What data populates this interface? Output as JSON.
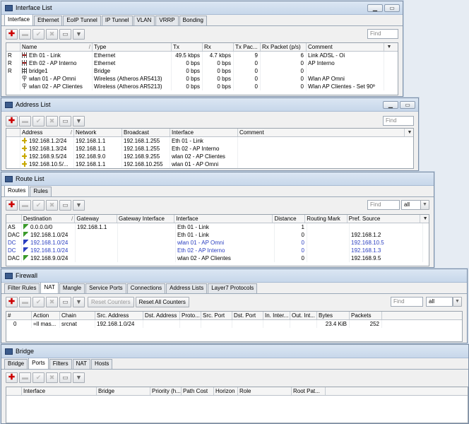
{
  "interface_list": {
    "title": "Interface List",
    "tabs": [
      "Interface",
      "Ethernet",
      "EoIP Tunnel",
      "IP Tunnel",
      "VLAN",
      "VRRP",
      "Bonding"
    ],
    "find": "Find",
    "minimize": "▁",
    "restore": "▭",
    "columns": [
      "Name",
      "Type",
      "Tx",
      "Rx",
      "Tx Pac...",
      "Rx Packet (p/s)",
      "Comment"
    ],
    "rows": [
      {
        "flag": "R",
        "icon": "ethernet-icon",
        "name": "Eth 01 - Link",
        "type": "Ethernet",
        "tx": "49.5 kbps",
        "rx": "4.7 kbps",
        "txp": "9",
        "rxp": "6",
        "comment": "Link ADSL - Oi"
      },
      {
        "flag": "R",
        "icon": "ethernet-icon",
        "name": "Eth 02 - AP Interno",
        "type": "Ethernet",
        "tx": "0 bps",
        "rx": "0 bps",
        "txp": "0",
        "rxp": "0",
        "comment": "AP Interno"
      },
      {
        "flag": "R",
        "icon": "bridge-icon",
        "name": "bridge1",
        "type": "Bridge",
        "tx": "0 bps",
        "rx": "0 bps",
        "txp": "0",
        "rxp": "0",
        "comment": ""
      },
      {
        "flag": "",
        "icon": "wireless-icon",
        "name": "wlan 01 - AP Omni",
        "type": "Wireless (Atheros AR5413)",
        "tx": "0 bps",
        "rx": "0 bps",
        "txp": "0",
        "rxp": "0",
        "comment": "Wlan AP Omni"
      },
      {
        "flag": "",
        "icon": "wireless-icon",
        "name": "wlan 02 - AP Clientes",
        "type": "Wireless (Atheros AR5213)",
        "tx": "0 bps",
        "rx": "0 bps",
        "txp": "0",
        "rxp": "0",
        "comment": "Wlan AP Clientes - Set 90º"
      }
    ]
  },
  "address_list": {
    "title": "Address List",
    "find": "Find",
    "columns": [
      "Address",
      "Network",
      "Broadcast",
      "Interface",
      "Comment"
    ],
    "rows": [
      {
        "address": "192.168.1.2/24",
        "network": "192.168.1.1",
        "broadcast": "192.168.1.255",
        "interface": "Eth 01 - Link"
      },
      {
        "address": "192.168.1.3/24",
        "network": "192.168.1.1",
        "broadcast": "192.168.1.255",
        "interface": "Eth 02 - AP Interno"
      },
      {
        "address": "192.168.9.5/24",
        "network": "192.168.9.0",
        "broadcast": "192.168.9.255",
        "interface": "wlan 02 - AP Clientes"
      },
      {
        "address": "192.168.10.5/...",
        "network": "192.168.1.1",
        "broadcast": "192.168.10.255",
        "interface": "wlan 01 - AP Omni"
      }
    ]
  },
  "route_list": {
    "title": "Route List",
    "tabs": [
      "Routes",
      "Rules"
    ],
    "find": "Find",
    "filter": "all",
    "columns": [
      "Destination",
      "Gateway",
      "Gateway Interface",
      "Interface",
      "Distance",
      "Routing Mark",
      "Pref. Source"
    ],
    "rows": [
      {
        "flag": "AS",
        "dest": "0.0.0.0/0",
        "gateway": "192.168.1.1",
        "gwif": "",
        "iface": "Eth 01 - Link",
        "distance": "1",
        "mark": "",
        "pref": "",
        "blue": false
      },
      {
        "flag": "DAC",
        "dest": "192.168.1.0/24",
        "gateway": "",
        "gwif": "",
        "iface": "Eth 01 - Link",
        "distance": "0",
        "mark": "",
        "pref": "192.168.1.2",
        "blue": false
      },
      {
        "flag": "DC",
        "dest": "192.168.1.0/24",
        "gateway": "",
        "gwif": "",
        "iface": "wlan 01 - AP Omni",
        "distance": "0",
        "mark": "",
        "pref": "192.168.10.5",
        "blue": true
      },
      {
        "flag": "DC",
        "dest": "192.168.1.0/24",
        "gateway": "",
        "gwif": "",
        "iface": "Eth 02 - AP Interno",
        "distance": "0",
        "mark": "",
        "pref": "192.168.1.3",
        "blue": true
      },
      {
        "flag": "DAC",
        "dest": "192.168.9.0/24",
        "gateway": "",
        "gwif": "",
        "iface": "wlan 02 - AP Clientes",
        "distance": "0",
        "mark": "",
        "pref": "192.168.9.5",
        "blue": false
      }
    ]
  },
  "firewall": {
    "title": "Firewall",
    "tabs": [
      "Filter Rules",
      "NAT",
      "Mangle",
      "Service Ports",
      "Connections",
      "Address Lists",
      "Layer7 Protocols"
    ],
    "reset_counters": "Reset Counters",
    "reset_all": "Reset All Counters",
    "find": "Find",
    "filter": "all",
    "columns": [
      "#",
      "Action",
      "Chain",
      "Src. Address",
      "Dst. Address",
      "Proto...",
      "Src. Port",
      "Dst. Port",
      "In. Inter...",
      "Out. Int...",
      "Bytes",
      "Packets"
    ],
    "rows": [
      {
        "num": "0",
        "action": "=ll mas...",
        "chain": "srcnat",
        "src": "192.168.1.0/24",
        "bytes": "23.4 KiB",
        "packets": "252"
      }
    ]
  },
  "bridge": {
    "title": "Bridge",
    "tabs": [
      "Bridge",
      "Ports",
      "Filters",
      "NAT",
      "Hosts"
    ],
    "columns": [
      "Interface",
      "Bridge",
      "Priority (h...",
      "Path Cost",
      "Horizon",
      "Role",
      "Root Pat..."
    ]
  }
}
